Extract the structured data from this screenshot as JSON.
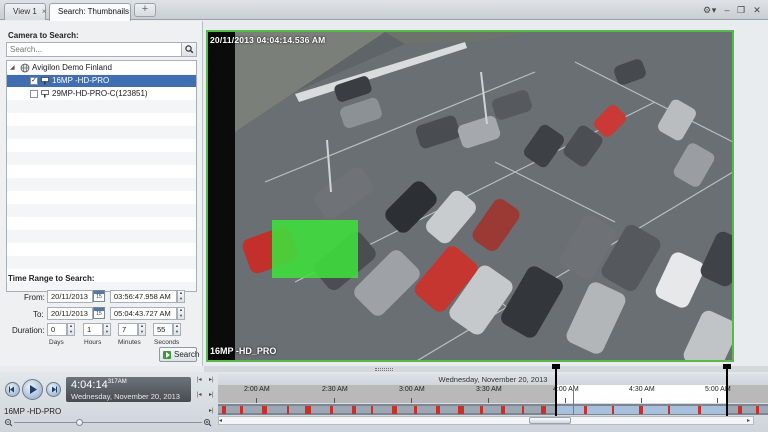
{
  "tabs": [
    {
      "label": "View 1",
      "close": "×",
      "active": false
    },
    {
      "label": "Search: Thumbnails",
      "close": "×",
      "active": true
    }
  ],
  "new_tab_label": "+",
  "window_controls": {
    "settings": "⚙",
    "dropdown": "▾",
    "minimize": "–",
    "restore": "❐",
    "close": "✕"
  },
  "left": {
    "camera_heading": "Camera to Search:",
    "search_placeholder": "Search...",
    "tree": {
      "site": "Avigilon Demo Finland",
      "cameras": [
        {
          "name": "16MP -HD-PRO",
          "checked": true,
          "selected": true
        },
        {
          "name": "29MP-HD-PRO-C(123851)",
          "checked": false,
          "selected": false
        }
      ]
    },
    "time_heading": "Time Range to Search:",
    "from_label": "From:",
    "from_date": "20/11/2013",
    "from_time": "03:56:47.958 AM",
    "to_label": "To:",
    "to_date": "20/11/2013",
    "to_time": "05:04:43.727 AM",
    "calendar_day": "15",
    "duration_label": "Duration:",
    "duration": {
      "days": "0",
      "hours": "1",
      "minutes": "7",
      "seconds": "55"
    },
    "duration_units": {
      "days": "Days",
      "hours": "Hours",
      "minutes": "Minutes",
      "seconds": "Seconds"
    },
    "search_button": "Search"
  },
  "video": {
    "timestamp": "20/11/2013 04:04:14.536 AM",
    "camera_name": "16MP -HD_PRO",
    "border_color": "#56b94a",
    "motion_box_color": "#3ee03a"
  },
  "playback": {
    "time": "4:04:14",
    "ms": "317",
    "ampm": "AM",
    "date": "Wednesday, November 20, 2013"
  },
  "timeline": {
    "date_header": "Wednesday, November 20, 2013",
    "ticks": [
      "2:00 AM",
      "2:30 AM",
      "3:00 AM",
      "3:30 AM",
      "4:00 AM",
      "4:30 AM",
      "5:00 AM"
    ],
    "camera_label": "16MP -HD-PRO",
    "recording_color": "#c9302c",
    "selection_start": "03:56:47.958 AM",
    "selection_end": "05:04:43.727 AM",
    "playhead": "4:04:14 AM"
  }
}
